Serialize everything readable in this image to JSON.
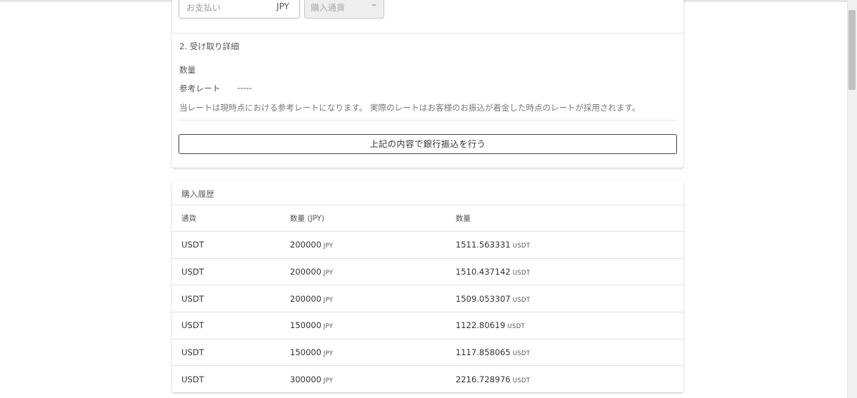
{
  "top_form": {
    "payment_input_placeholder": "お支払い",
    "payment_currency": "JPY",
    "currency_select_value": "購入通貨"
  },
  "receive_details": {
    "title": "2. 受け取り詳細",
    "quantity_label": "数量",
    "rate_label": "参考レート",
    "rate_value": "-----",
    "note": "当レートは現時点における参考レートになります。 実際のレートはお客様のお振込が着金した時点のレートが採用されます。",
    "submit_button_label": "上記の内容で銀行振込を行う"
  },
  "purchase_history": {
    "title": "購入履歴",
    "columns": [
      "通貨",
      "数量 (JPY)",
      "数量"
    ],
    "rows": [
      {
        "currency": "USDT",
        "amount_jpy": "200000",
        "amount_jpy_unit": "JPY",
        "quantity": "1511.563331",
        "quantity_unit": "USDT"
      },
      {
        "currency": "USDT",
        "amount_jpy": "200000",
        "amount_jpy_unit": "JPY",
        "quantity": "1510.437142",
        "quantity_unit": "USDT"
      },
      {
        "currency": "USDT",
        "amount_jpy": "200000",
        "amount_jpy_unit": "JPY",
        "quantity": "1509.053307",
        "quantity_unit": "USDT"
      },
      {
        "currency": "USDT",
        "amount_jpy": "150000",
        "amount_jpy_unit": "JPY",
        "quantity": "1122.80619",
        "quantity_unit": "USDT"
      },
      {
        "currency": "USDT",
        "amount_jpy": "150000",
        "amount_jpy_unit": "JPY",
        "quantity": "1117.858065",
        "quantity_unit": "USDT"
      },
      {
        "currency": "USDT",
        "amount_jpy": "300000",
        "amount_jpy_unit": "JPY",
        "quantity": "2216.728976",
        "quantity_unit": "USDT"
      }
    ]
  },
  "colors": {
    "background": "#ffffff",
    "card_border": "#e3e3e3",
    "button_border": "#444444",
    "text_primary": "#333333",
    "text_muted": "#777777"
  }
}
